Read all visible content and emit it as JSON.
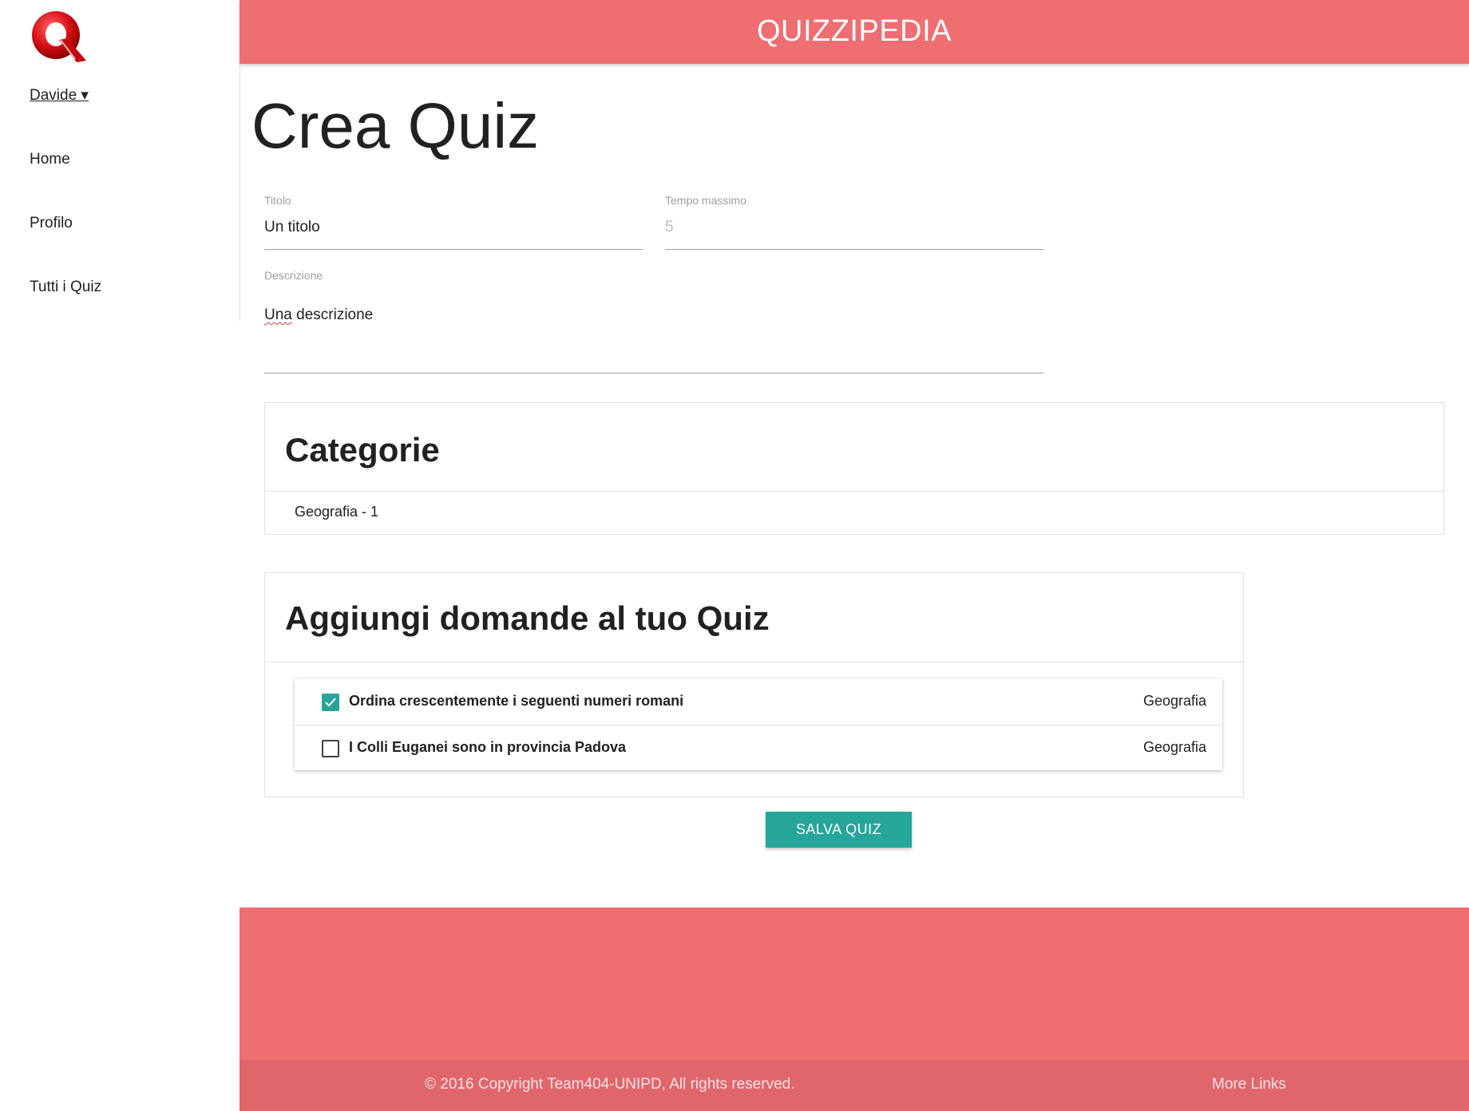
{
  "header": {
    "brand": "QUIZZIPEDIA"
  },
  "sidebar": {
    "user": "Davide ▾",
    "items": [
      {
        "label": "Home"
      },
      {
        "label": "Profilo"
      },
      {
        "label": "Tutti i Quiz"
      }
    ]
  },
  "main": {
    "title": "Crea Quiz",
    "form": {
      "title_label": "Titolo",
      "title_value": "Un titolo",
      "time_label": "Tempo massimo",
      "time_value": "5",
      "desc_label": "Descrizione",
      "desc_value_word1": "Una",
      "desc_value_rest": " descrizione"
    },
    "categories": {
      "heading": "Categorie",
      "items": [
        "Geografia - 1"
      ]
    },
    "questions": {
      "heading": "Aggiungi domande al tuo Quiz",
      "rows": [
        {
          "text": "Ordina crescentemente i seguenti numeri romani",
          "category": "Geografia",
          "checked": true
        },
        {
          "text": "I Colli Euganei sono in provincia Padova",
          "category": "Geografia",
          "checked": false
        }
      ]
    },
    "save_label": "SALVA QUIZ"
  },
  "footer": {
    "copyright": "© 2016 Copyright Team404-UNIPD, All rights reserved.",
    "more_links": "More Links"
  },
  "colors": {
    "brand": "#ef6e72",
    "accent": "#26a69a"
  }
}
